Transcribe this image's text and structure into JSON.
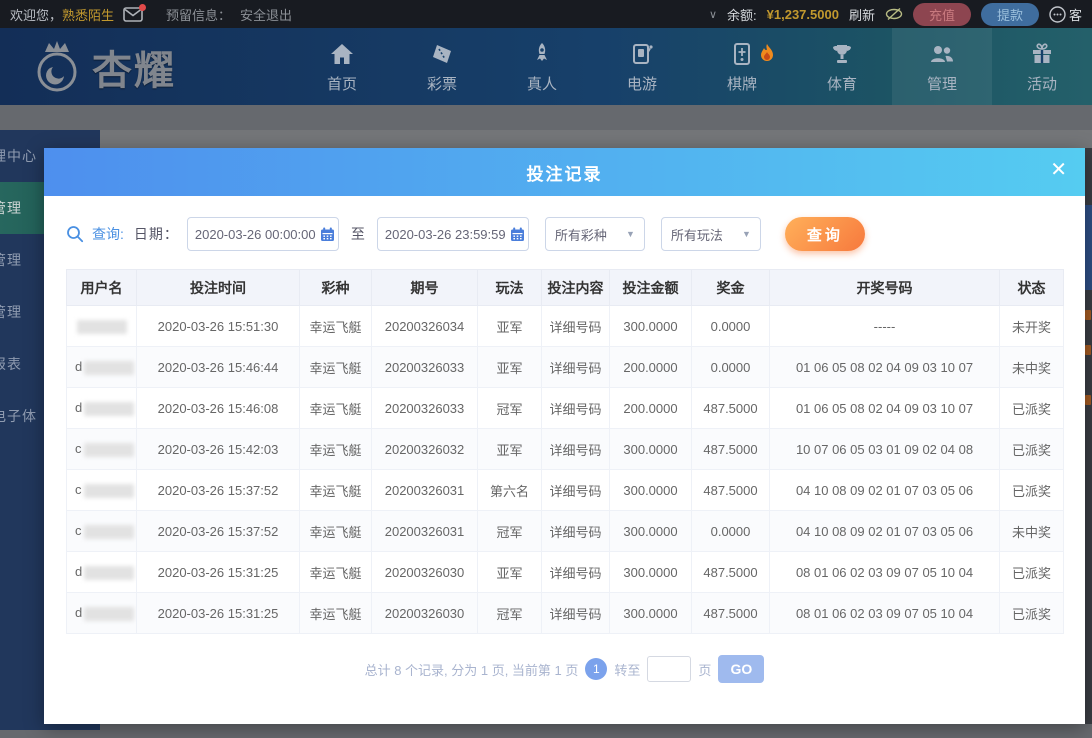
{
  "topbar": {
    "welcome_prefix": "欢迎您，",
    "username": "熟悉陌生",
    "reserved_info": "预留信息：",
    "logout": "安全退出",
    "balance_label": "余额:",
    "balance": "¥1,237.5000",
    "refresh": "刷新",
    "recharge": "充值",
    "withdraw": "提款",
    "service": "客"
  },
  "navbar": {
    "logo_text": "杏耀",
    "items": [
      {
        "label": "首页",
        "icon": "home-icon",
        "active": false,
        "hot": false
      },
      {
        "label": "彩票",
        "icon": "ticket-icon",
        "active": false,
        "hot": false
      },
      {
        "label": "真人",
        "icon": "live-person-icon",
        "active": false,
        "hot": false
      },
      {
        "label": "电游",
        "icon": "slot-machine-icon",
        "active": false,
        "hot": false
      },
      {
        "label": "棋牌",
        "icon": "board-game-icon",
        "active": false,
        "hot": true
      },
      {
        "label": "体育",
        "icon": "trophy-icon",
        "active": false,
        "hot": false
      },
      {
        "label": "管理",
        "icon": "users-icon",
        "active": true,
        "hot": false
      },
      {
        "label": "活动",
        "icon": "gift-icon",
        "active": false,
        "hot": false
      }
    ]
  },
  "sidebar": {
    "items": [
      {
        "label": "理中心",
        "active": false
      },
      {
        "label": "管理",
        "active": true
      },
      {
        "label": "管理",
        "active": false
      },
      {
        "label": "管理",
        "active": false
      },
      {
        "label": "报表",
        "active": false
      },
      {
        "label": "电子体",
        "active": false
      }
    ]
  },
  "modal": {
    "title": "投注记录",
    "close": "✕",
    "search": {
      "label": "查询:",
      "date_label": "日期：",
      "date_from": "2020-03-26 00:00:00",
      "to": "至",
      "date_to": "2020-03-26 23:59:59",
      "lottery_select": "所有彩种",
      "play_select": "所有玩法",
      "submit": "查询"
    },
    "table": {
      "headers": [
        "用户名",
        "投注时间",
        "彩种",
        "期号",
        "玩法",
        "投注内容",
        "投注金额",
        "奖金",
        "开奖号码",
        "状态"
      ],
      "rows": [
        {
          "user": "",
          "time": "2020-03-26 15:51:30",
          "lottery": "幸运飞艇",
          "issue": "20200326034",
          "play": "亚军",
          "content": "详细号码",
          "amount": "300.0000",
          "prize": "0.0000",
          "numbers": "-----",
          "status": "未开奖",
          "status_type": "open"
        },
        {
          "user": "d",
          "time": "2020-03-26 15:46:44",
          "lottery": "幸运飞艇",
          "issue": "20200326033",
          "play": "亚军",
          "content": "详细号码",
          "amount": "200.0000",
          "prize": "0.0000",
          "numbers": "01 06 05 08 02 04 09 03 10 07",
          "status": "未中奖",
          "status_type": "lost"
        },
        {
          "user": "d",
          "time": "2020-03-26 15:46:08",
          "lottery": "幸运飞艇",
          "issue": "20200326033",
          "play": "冠军",
          "content": "详细号码",
          "amount": "200.0000",
          "prize": "487.5000",
          "numbers": "01 06 05 08 02 04 09 03 10 07",
          "status": "已派奖",
          "status_type": "paid"
        },
        {
          "user": "c",
          "time": "2020-03-26 15:42:03",
          "lottery": "幸运飞艇",
          "issue": "20200326032",
          "play": "亚军",
          "content": "详细号码",
          "amount": "300.0000",
          "prize": "487.5000",
          "numbers": "10 07 06 05 03 01 09 02 04 08",
          "status": "已派奖",
          "status_type": "paid"
        },
        {
          "user": "c",
          "time": "2020-03-26 15:37:52",
          "lottery": "幸运飞艇",
          "issue": "20200326031",
          "play": "第六名",
          "content": "详细号码",
          "amount": "300.0000",
          "prize": "487.5000",
          "numbers": "04 10 08 09 02 01 07 03 05 06",
          "status": "已派奖",
          "status_type": "paid"
        },
        {
          "user": "c",
          "time": "2020-03-26 15:37:52",
          "lottery": "幸运飞艇",
          "issue": "20200326031",
          "play": "冠军",
          "content": "详细号码",
          "amount": "300.0000",
          "prize": "0.0000",
          "numbers": "04 10 08 09 02 01 07 03 05 06",
          "status": "未中奖",
          "status_type": "lost"
        },
        {
          "user": "d",
          "time": "2020-03-26 15:31:25",
          "lottery": "幸运飞艇",
          "issue": "20200326030",
          "play": "亚军",
          "content": "详细号码",
          "amount": "300.0000",
          "prize": "487.5000",
          "numbers": "08 01 06 02 03 09 07 05 10 04",
          "status": "已派奖",
          "status_type": "paid"
        },
        {
          "user": "d",
          "time": "2020-03-26 15:31:25",
          "lottery": "幸运飞艇",
          "issue": "20200326030",
          "play": "冠军",
          "content": "详细号码",
          "amount": "300.0000",
          "prize": "487.5000",
          "numbers": "08 01 06 02 03 09 07 05 10 04",
          "status": "已派奖",
          "status_type": "paid"
        }
      ]
    },
    "pagination": {
      "summary": "总计 8 个记录, 分为 1 页, 当前第 1 页",
      "current_page": "1",
      "goto_label": "转至",
      "page_unit": "页",
      "go": "GO"
    }
  },
  "colors": {
    "accent_orange": "#f7793d",
    "modal_gradient_start": "#4e8fee",
    "modal_gradient_end": "#55ccf1",
    "status_paid": "#f2683c",
    "status_lost": "#c3c3c3",
    "status_open": "#3f9e44",
    "detail_link_green": "#3aa045",
    "balance_gold": "#c2992e"
  }
}
